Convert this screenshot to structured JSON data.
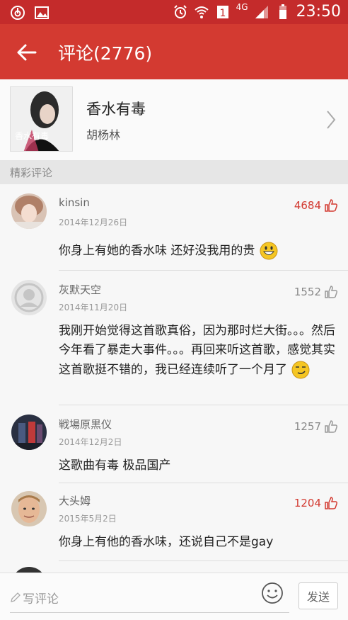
{
  "status_bar": {
    "time": "23:50",
    "network": "4G"
  },
  "header": {
    "title": "评论(2776)"
  },
  "song": {
    "title": "香水有毒",
    "artist": "胡杨林",
    "cover_text": "香水有毒"
  },
  "section_label": "精彩评论",
  "comments": [
    {
      "user": "kinsin",
      "date": "2014年12月26日",
      "likes": "4684",
      "liked": true,
      "text": "你身上有她的香水味 还好没我用的贵",
      "emoji": "grin-emoji"
    },
    {
      "user": "灰默天空",
      "date": "2014年11月20日",
      "likes": "1552",
      "liked": false,
      "text": "我刚开始觉得这首歌真俗，因为那时烂大街。。。然后今年看了暴走大事件。。。再回来听这首歌，感觉其实这首歌挺不错的，我已经连续听了一个月了",
      "emoji": "smirk-emoji"
    },
    {
      "user": "戦場原黒仪",
      "date": "2014年12月2日",
      "likes": "1257",
      "liked": false,
      "text": "这歌曲有毒  极品国产"
    },
    {
      "user": "大头姆",
      "date": "2015年5月2日",
      "likes": "1204",
      "liked": true,
      "text": "你身上有他的香水味，还说自己不是gay"
    }
  ],
  "input": {
    "placeholder": "写评论",
    "send_label": "发送"
  },
  "colors": {
    "brand_red": "#d33a31",
    "statusbar_red": "#c42b2b",
    "liked_red": "#d33a31"
  }
}
